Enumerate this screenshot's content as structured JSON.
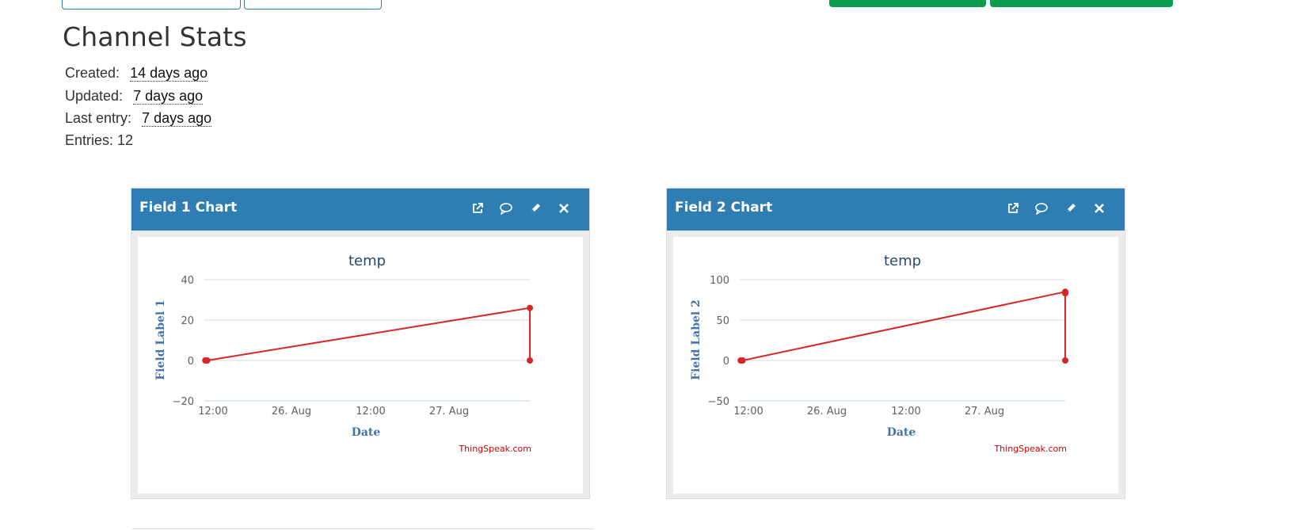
{
  "page": {
    "title": "Channel Stats",
    "stats": [
      {
        "label": "Created:",
        "value": "14 days ago"
      },
      {
        "label": "Updated:",
        "value": "7 days ago"
      },
      {
        "label": "Last entry:",
        "value": "7 days ago"
      },
      {
        "label": "Entries: 12",
        "value": ""
      }
    ]
  },
  "colors": {
    "panel_header": "#2e7db3",
    "series": "#d62728",
    "top_button_green": "#0a9d4d",
    "credit": "#d00000",
    "axis_title": "#4572a7"
  },
  "panels": [
    {
      "title": "Field 1 Chart",
      "icons": [
        "external-link-icon",
        "comment-icon",
        "pencil-icon",
        "close-icon"
      ]
    },
    {
      "title": "Field 2 Chart",
      "icons": [
        "external-link-icon",
        "comment-icon",
        "pencil-icon",
        "close-icon"
      ]
    }
  ],
  "chart_data": [
    {
      "type": "line",
      "title": "temp",
      "xlabel": "Date",
      "ylabel": "Field Label 1",
      "yticks": [
        "40",
        "20",
        "0",
        "−20"
      ],
      "ylim": [
        -20,
        40
      ],
      "xticks": [
        "12:00",
        "26. Aug",
        "12:00",
        "27. Aug"
      ],
      "xlim": [
        "2023-08-25T11:30",
        "2023-08-27T20:00"
      ],
      "grid": true,
      "credit": "ThingSpeak.com",
      "series": [
        {
          "points": [
            {
              "x": "2023-08-25T11:40",
              "y": 0
            },
            {
              "x": "2023-08-25T12:00",
              "y": 0
            },
            {
              "x": "2023-08-27T20:00",
              "y": 26
            },
            {
              "x": "2023-08-27T20:00",
              "y": 0
            }
          ]
        }
      ]
    },
    {
      "type": "line",
      "title": "temp",
      "xlabel": "Date",
      "ylabel": "Field Label 2",
      "yticks": [
        "100",
        "50",
        "0",
        "−50"
      ],
      "ylim": [
        -50,
        100
      ],
      "xticks": [
        "12:00",
        "26. Aug",
        "12:00",
        "27. Aug"
      ],
      "xlim": [
        "2023-08-25T11:30",
        "2023-08-27T20:00"
      ],
      "grid": true,
      "credit": "ThingSpeak.com",
      "series": [
        {
          "points": [
            {
              "x": "2023-08-25T11:40",
              "y": 0
            },
            {
              "x": "2023-08-25T12:00",
              "y": 0
            },
            {
              "x": "2023-08-27T20:00",
              "y": 85
            },
            {
              "x": "2023-08-27T20:00",
              "y": 83
            },
            {
              "x": "2023-08-27T20:00",
              "y": 0
            }
          ]
        }
      ]
    }
  ]
}
